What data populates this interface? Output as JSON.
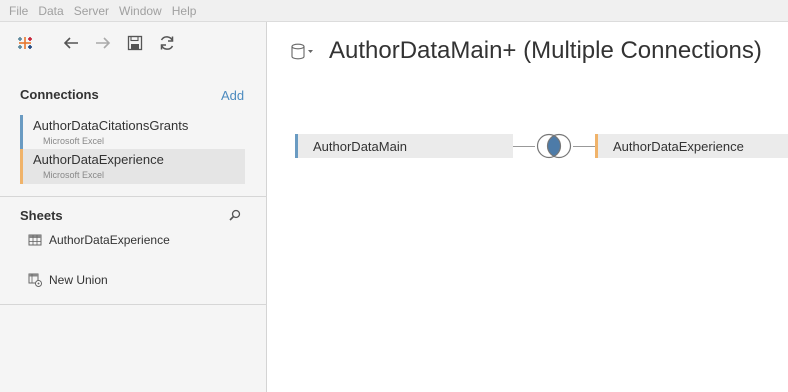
{
  "menu": {
    "items": [
      "File",
      "Data",
      "Server",
      "Window",
      "Help"
    ]
  },
  "toolbar": {
    "icons": [
      "tableau-logo-icon",
      "back-arrow-icon",
      "forward-arrow-icon",
      "save-icon",
      "refresh-icon"
    ]
  },
  "connections": {
    "header": "Connections",
    "add_label": "Add",
    "items": [
      {
        "name": "AuthorDataCitationsGrants",
        "type": "Microsoft Excel",
        "color": "#6a9bc2"
      },
      {
        "name": "AuthorDataExperience",
        "type": "Microsoft Excel",
        "color": "#f0b36a"
      }
    ]
  },
  "sheets": {
    "header": "Sheets",
    "items": [
      {
        "label": "AuthorDataExperience",
        "icon": "sheet-table-icon"
      },
      {
        "label": "New Union",
        "icon": "union-icon"
      }
    ]
  },
  "canvas": {
    "title": "AuthorDataMain+ (Multiple Connections)",
    "join_type": "inner",
    "left_table": {
      "label": "AuthorDataMain",
      "color": "#6a9bc2"
    },
    "right_table": {
      "label": "AuthorDataExperience",
      "color": "#f0b36a"
    }
  }
}
